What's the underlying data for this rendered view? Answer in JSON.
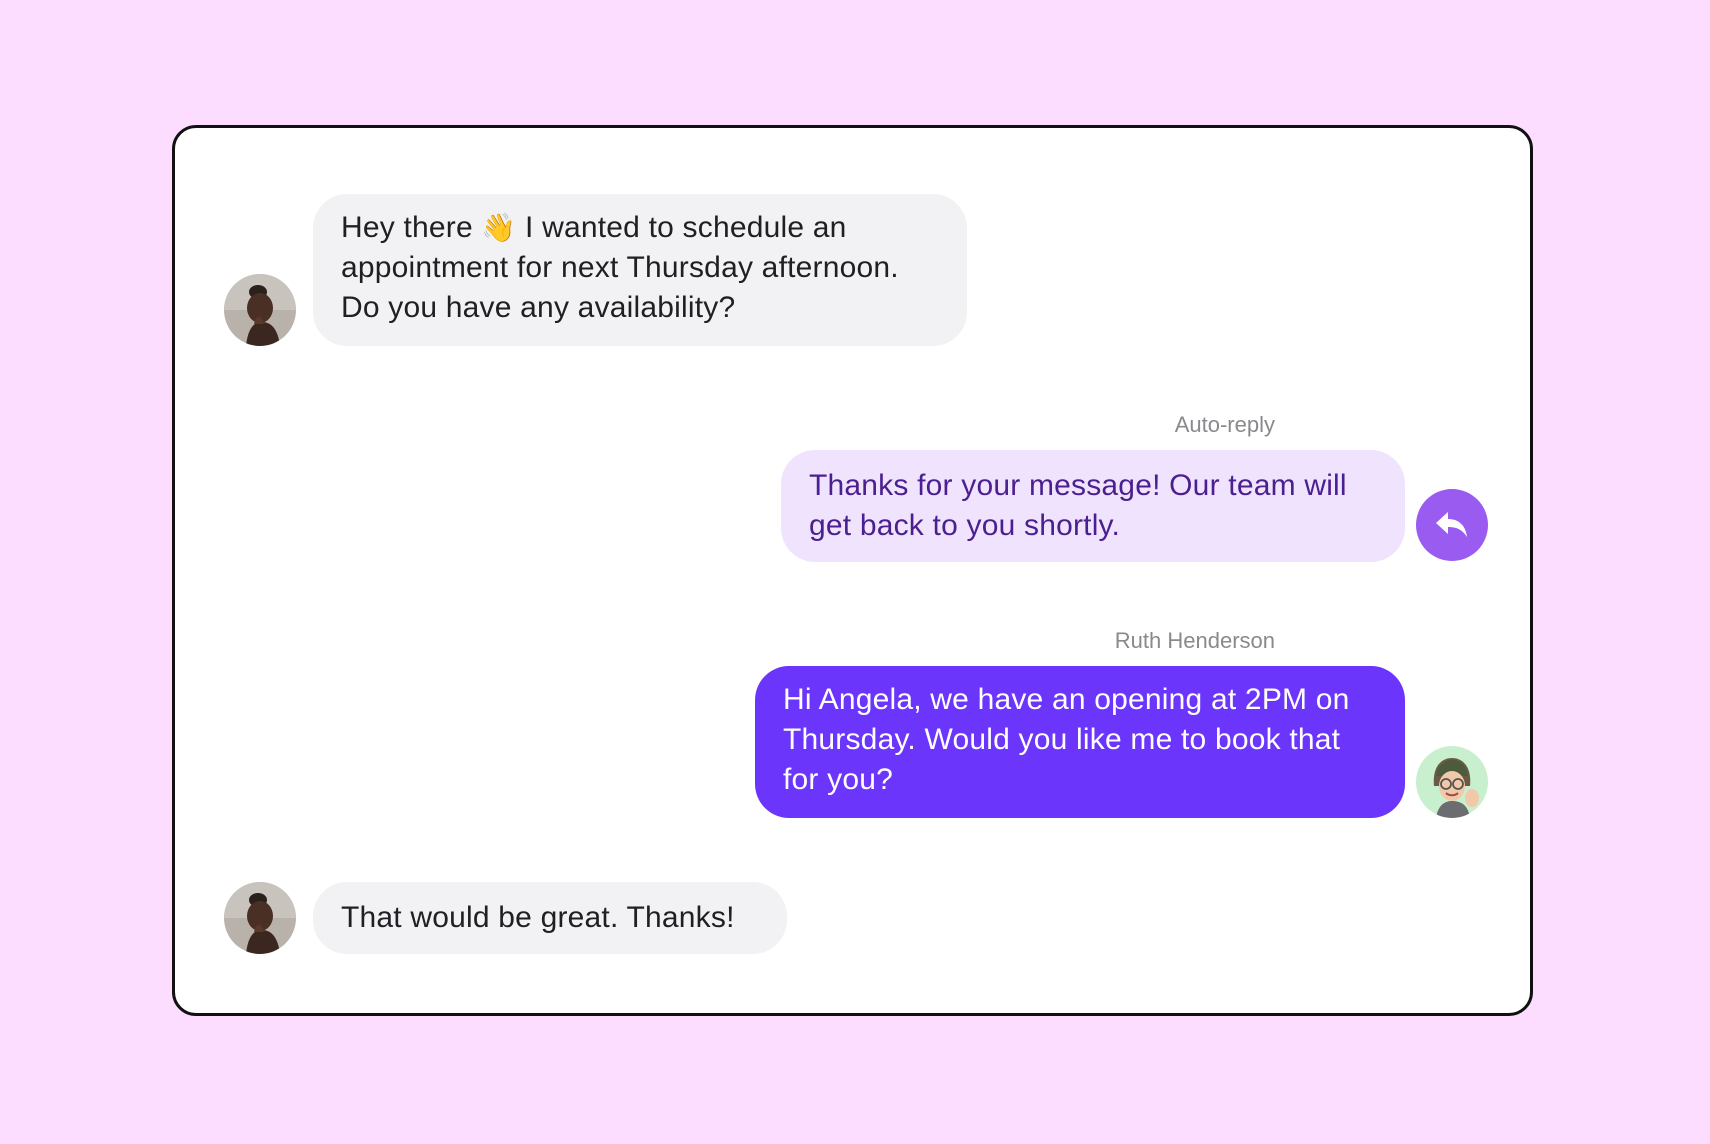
{
  "messages": [
    {
      "sender": "customer",
      "lines": [
        "Hey there",
        "I wanted to schedule an",
        "appointment for next Thursday afternoon.",
        "Do you have any availability?"
      ],
      "emoji": "👋"
    },
    {
      "sender": "auto",
      "label": "Auto-reply",
      "lines": [
        "Thanks for your message! Our team will",
        "get back to you shortly."
      ]
    },
    {
      "sender": "agent",
      "label": "Ruth Henderson",
      "lines": [
        "Hi Angela, we have an opening at 2PM on",
        "Thursday. Would you like me to book that",
        "for you?"
      ]
    },
    {
      "sender": "customer",
      "lines": [
        "That would be great. Thanks!"
      ]
    }
  ],
  "colors": {
    "page_background": "#fcdcff",
    "customer_bubble": "#f2f2f4",
    "auto_reply_bubble": "#efe3fd",
    "auto_reply_text": "#4b1f8f",
    "agent_bubble": "#6b35fc",
    "reply_icon_background": "#9a5bf1",
    "agent_avatar_background": "#c8f0cf"
  },
  "icons": {
    "auto_reply": "reply-arrow-icon",
    "customer_avatar": "customer-avatar",
    "agent_avatar": "agent-avatar"
  }
}
